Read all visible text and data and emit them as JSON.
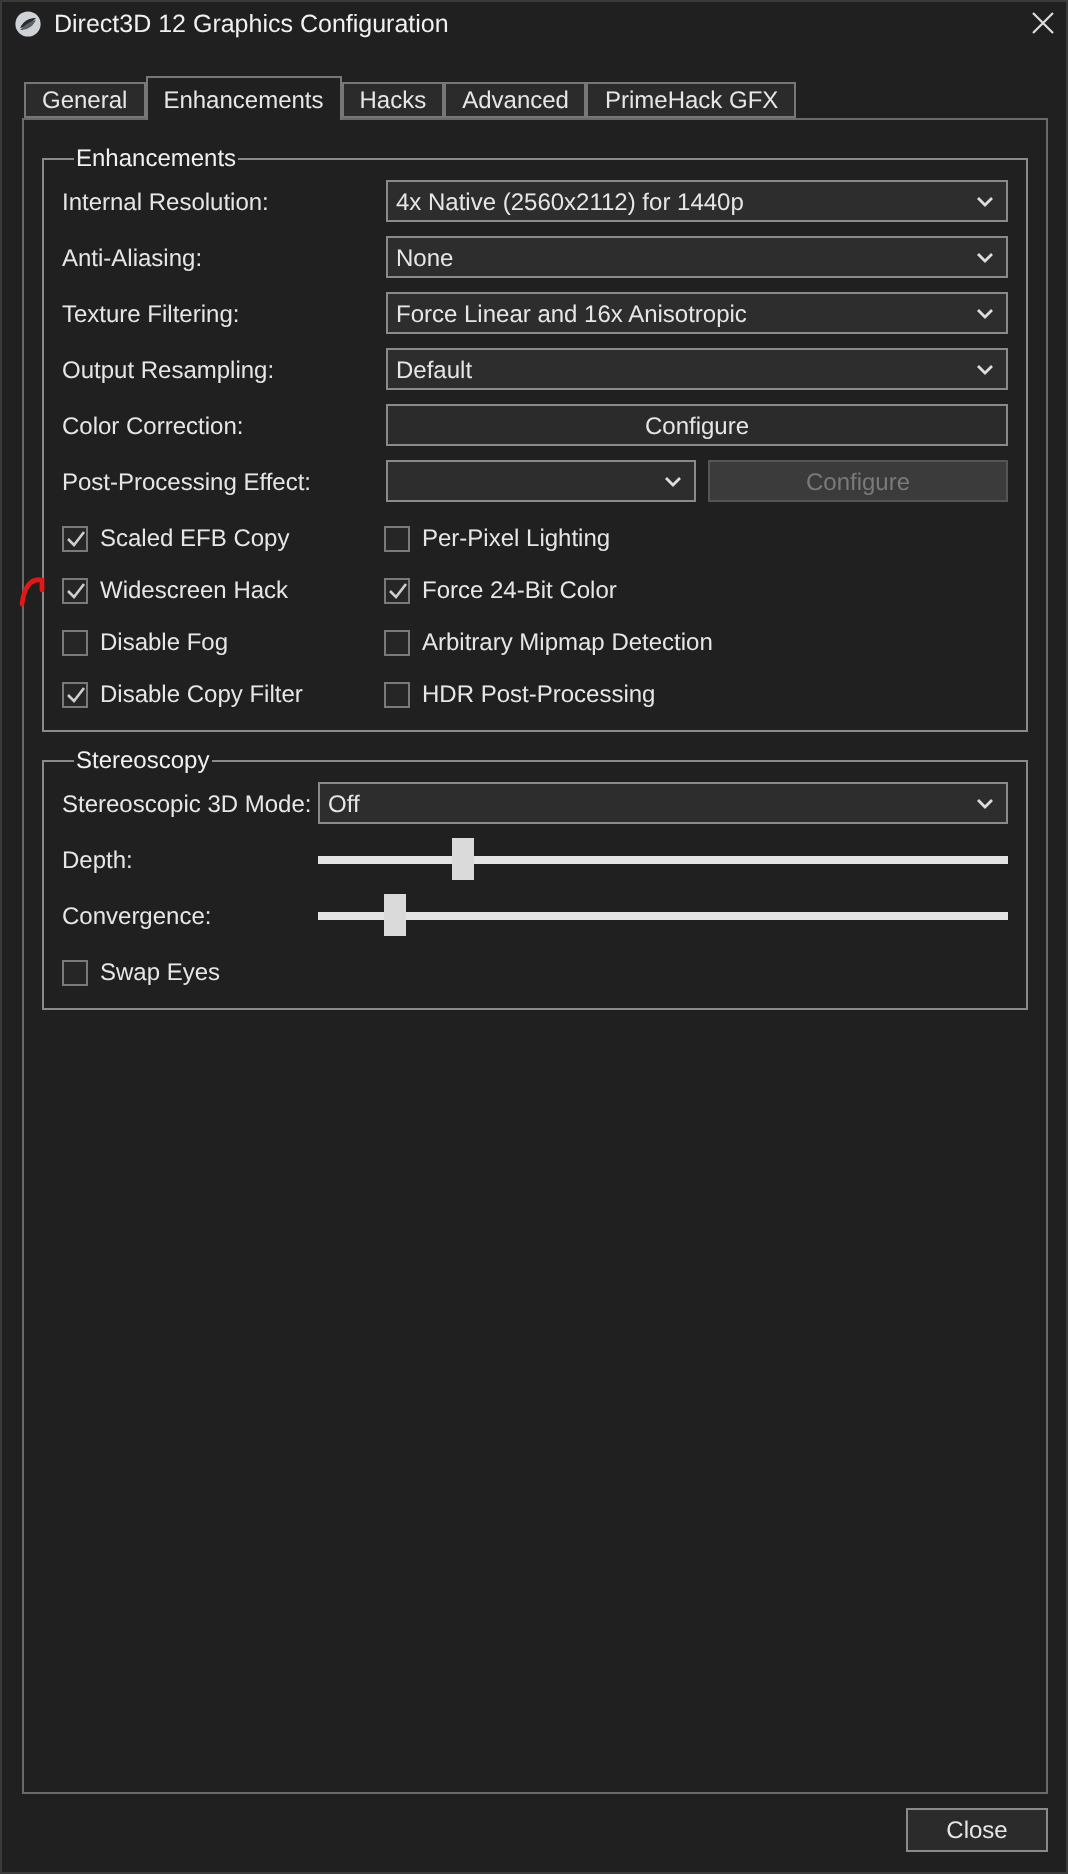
{
  "window": {
    "title": "Direct3D 12 Graphics Configuration"
  },
  "tabs": [
    {
      "label": "General",
      "selected": false
    },
    {
      "label": "Enhancements",
      "selected": true
    },
    {
      "label": "Hacks",
      "selected": false
    },
    {
      "label": "Advanced",
      "selected": false
    },
    {
      "label": "PrimeHack GFX",
      "selected": false
    }
  ],
  "enhancements": {
    "title": "Enhancements",
    "rows": [
      {
        "kind": "dropdown",
        "label": "Internal Resolution:",
        "value": "4x Native (2560x2112) for 1440p"
      },
      {
        "kind": "dropdown",
        "label": "Anti-Aliasing:",
        "value": "None"
      },
      {
        "kind": "dropdown",
        "label": "Texture Filtering:",
        "value": "Force Linear and 16x Anisotropic"
      },
      {
        "kind": "dropdown",
        "label": "Output Resampling:",
        "value": "Default"
      },
      {
        "kind": "button",
        "label": "Color Correction:",
        "button": "Configure",
        "disabled": false
      },
      {
        "kind": "dropdown_button",
        "label": "Post-Processing Effect:",
        "button": "Configure",
        "disabled": true
      }
    ],
    "checkboxes": [
      {
        "label": "Scaled EFB Copy",
        "checked": true
      },
      {
        "label": "Per-Pixel Lighting",
        "checked": false
      },
      {
        "label": "Widescreen Hack",
        "checked": true,
        "annotated": true
      },
      {
        "label": "Force 24-Bit Color",
        "checked": true
      },
      {
        "label": "Disable Fog",
        "checked": false
      },
      {
        "label": "Arbitrary Mipmap Detection",
        "checked": false
      },
      {
        "label": "Disable Copy Filter",
        "checked": true
      },
      {
        "label": "HDR Post-Processing",
        "checked": false
      }
    ]
  },
  "stereoscopy": {
    "title": "Stereoscopy",
    "rows": [
      {
        "kind": "dropdown",
        "label": "Stereoscopic 3D Mode:",
        "value": "Off"
      },
      {
        "kind": "slider",
        "label": "Depth:",
        "level": 0.21
      },
      {
        "kind": "slider",
        "label": "Convergence:",
        "level": 0.11
      },
      {
        "kind": "checkbox",
        "label": "Swap Eyes",
        "checked": false
      }
    ]
  },
  "close_button": "Close"
}
